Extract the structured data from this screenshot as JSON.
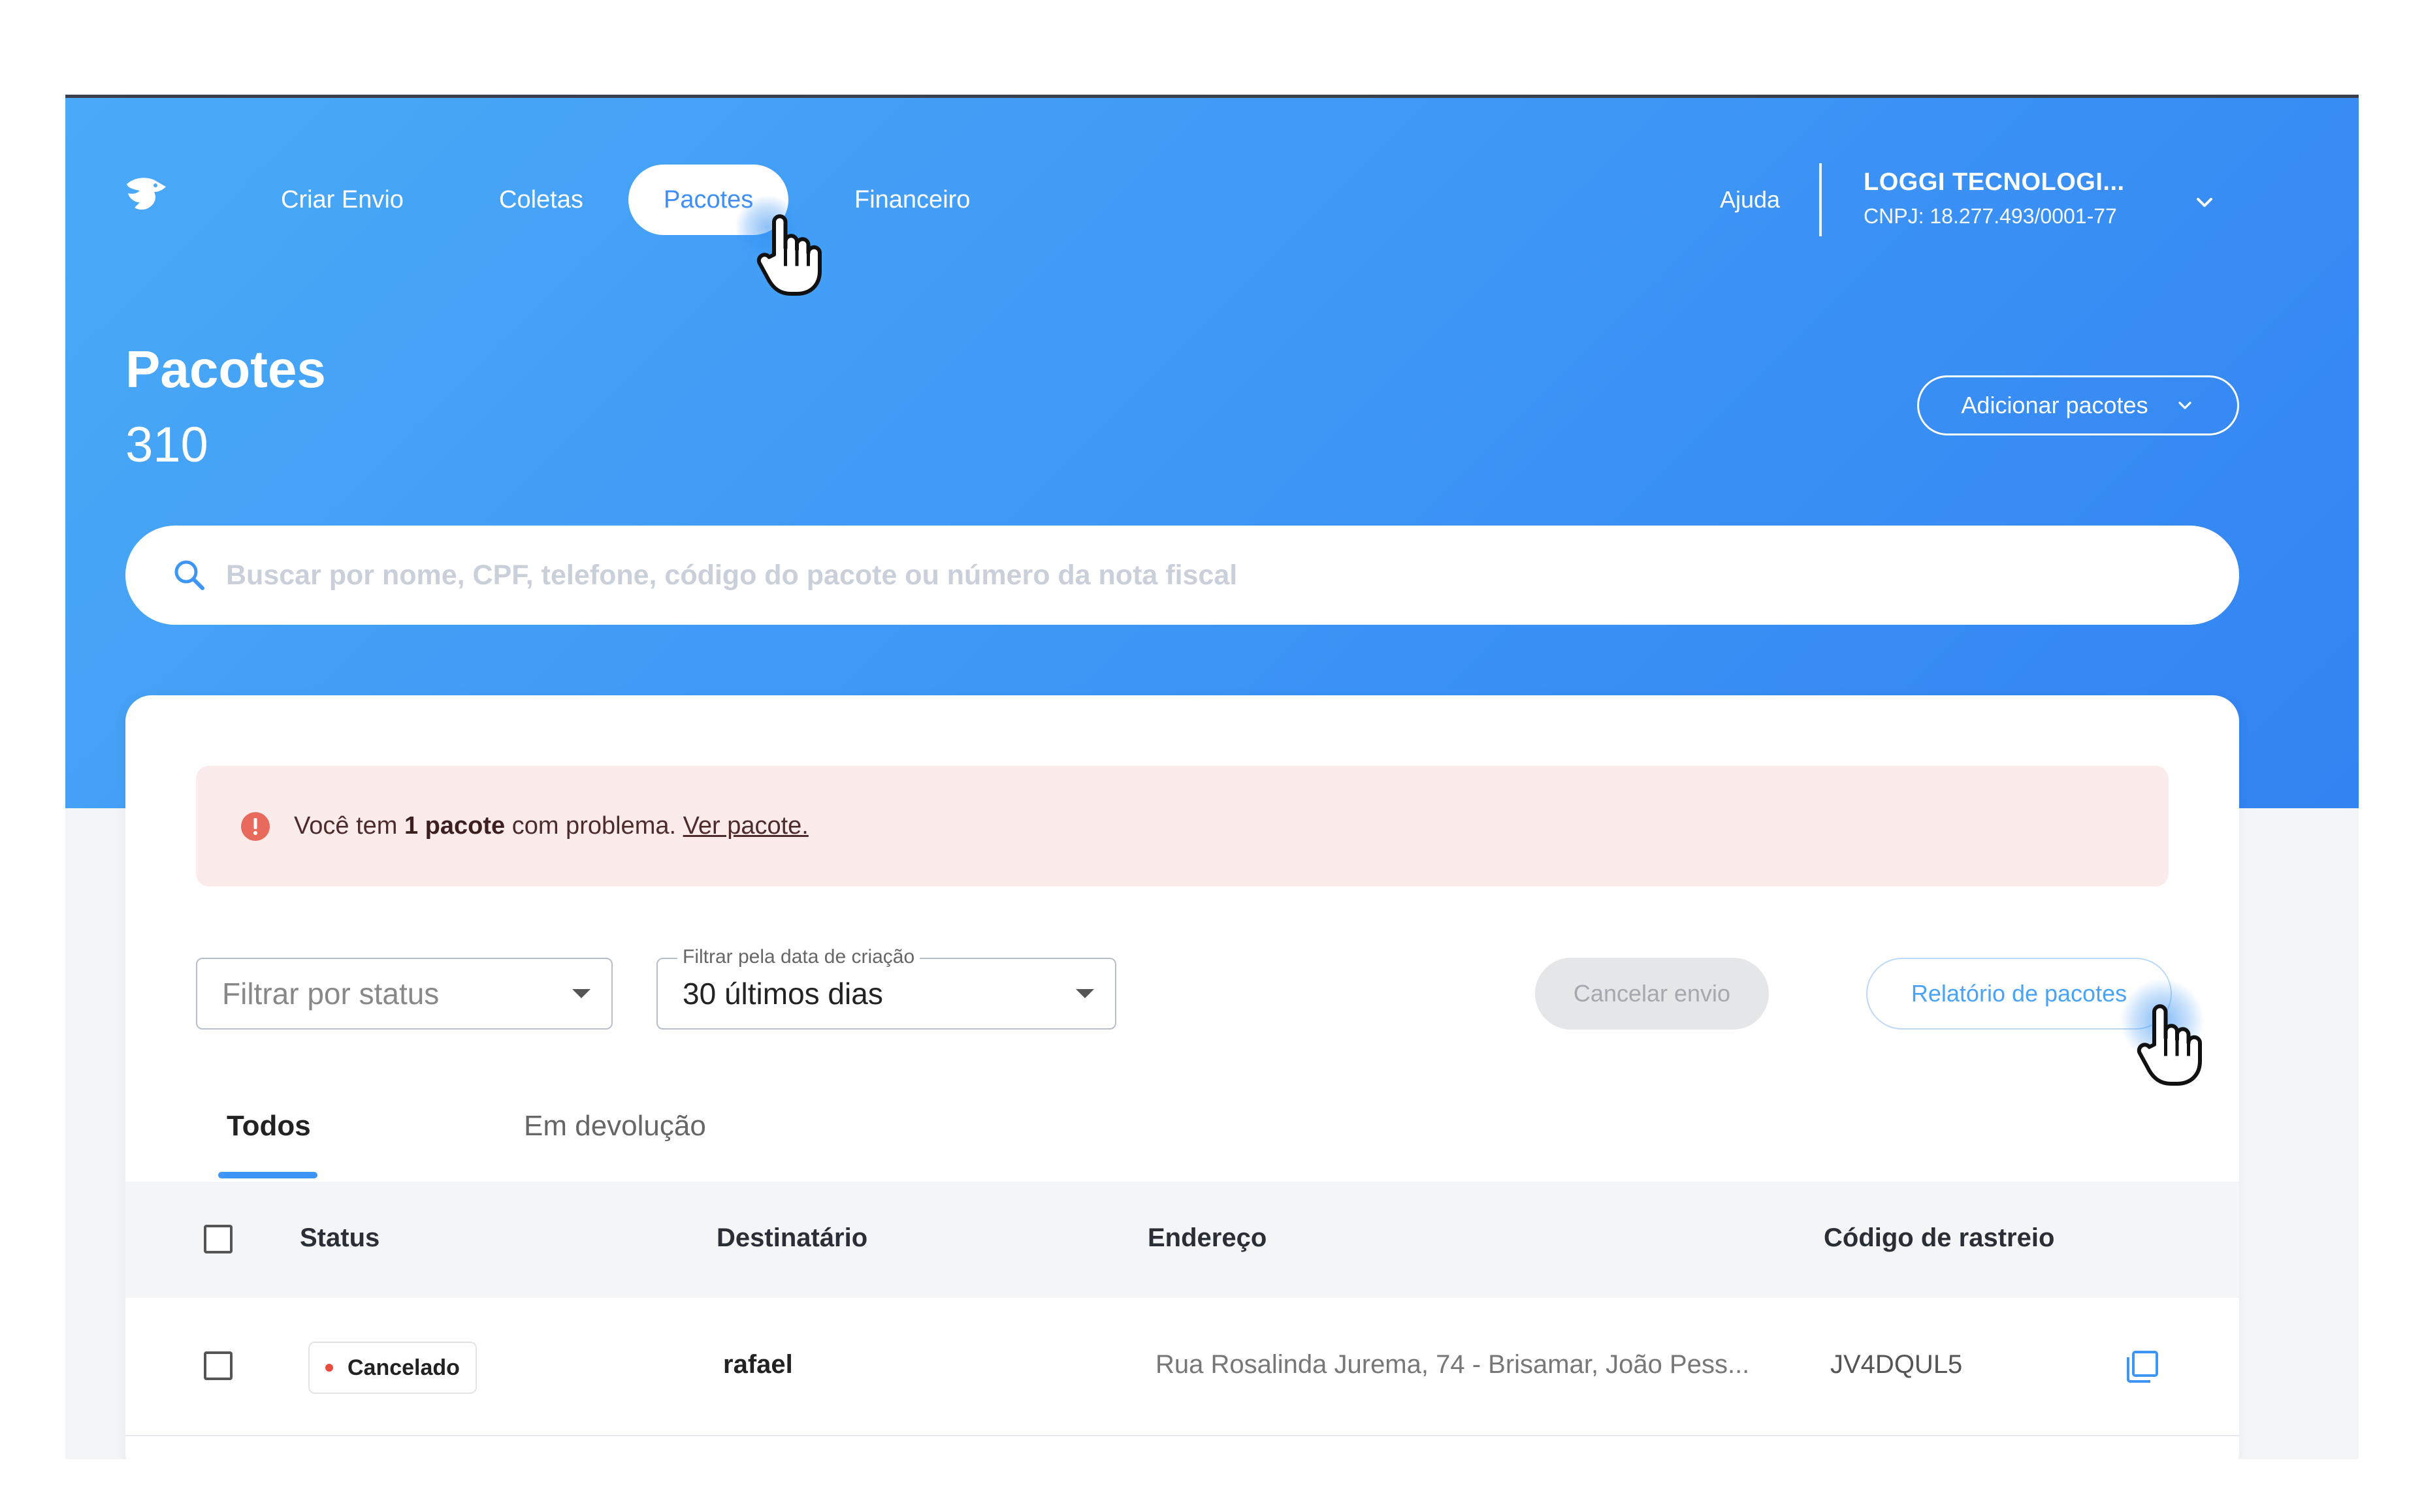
{
  "nav": {
    "items": [
      "Criar Envio",
      "Coletas",
      "Pacotes",
      "Financeiro"
    ],
    "active": "Pacotes",
    "help": "Ajuda",
    "company_name": "LOGGI TECNOLOGI...",
    "company_cnpj": "CNPJ: 18.277.493/0001-77"
  },
  "header": {
    "title": "Pacotes",
    "count": "310",
    "add_button": "Adicionar pacotes"
  },
  "search": {
    "placeholder": "Buscar por nome, CPF, telefone, código do pacote ou número da nota fiscal"
  },
  "alert": {
    "prefix": "Você tem ",
    "bold": "1 pacote",
    "middle": " com problema. ",
    "link": "Ver pacote."
  },
  "filters": {
    "status_placeholder": "Filtrar por status",
    "date_label": "Filtrar pela data de criação",
    "date_value": "30 últimos dias",
    "cancel_button": "Cancelar envio",
    "report_button": "Relatório de pacotes"
  },
  "tabs": [
    "Todos",
    "Em devolução"
  ],
  "table": {
    "columns": [
      "Status",
      "Destinatário",
      "Endereço",
      "Código de rastreio"
    ],
    "rows": [
      {
        "status": "Cancelado",
        "recipient": "rafael",
        "address": "Rua Rosalinda Jurema, 74 - Brisamar, João Pess...",
        "tracking": "JV4DQUL5"
      }
    ]
  },
  "colors": {
    "hero_gradient_start": "#4aaaf7",
    "hero_gradient_end": "#3383f2",
    "accent": "#3d95f5",
    "alert_bg": "#fbeceb",
    "alert_icon": "#e86a5c",
    "status_dot": "#e74c3c"
  },
  "icons": [
    "loggi-logo-icon",
    "chevron-down-icon",
    "search-icon",
    "alert-icon",
    "copy-icon",
    "hand-cursor-icon"
  ]
}
